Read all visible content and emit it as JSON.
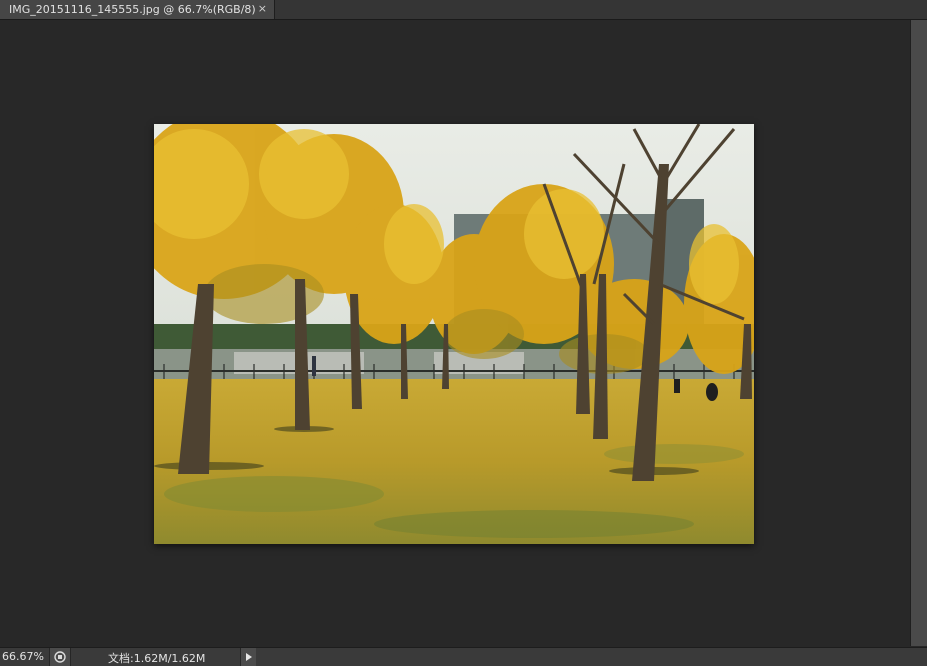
{
  "tab": {
    "title": "IMG_20151116_145555.jpg @ 66.7%(RGB/8)",
    "close_icon": "×"
  },
  "status": {
    "zoom": "66.67%",
    "doc_info": "文档:1.62M/1.62M",
    "menu_icon": "right-arrow-icon"
  },
  "colors": {
    "background": "#282828",
    "panel": "#353535",
    "tab_active": "#464646"
  }
}
